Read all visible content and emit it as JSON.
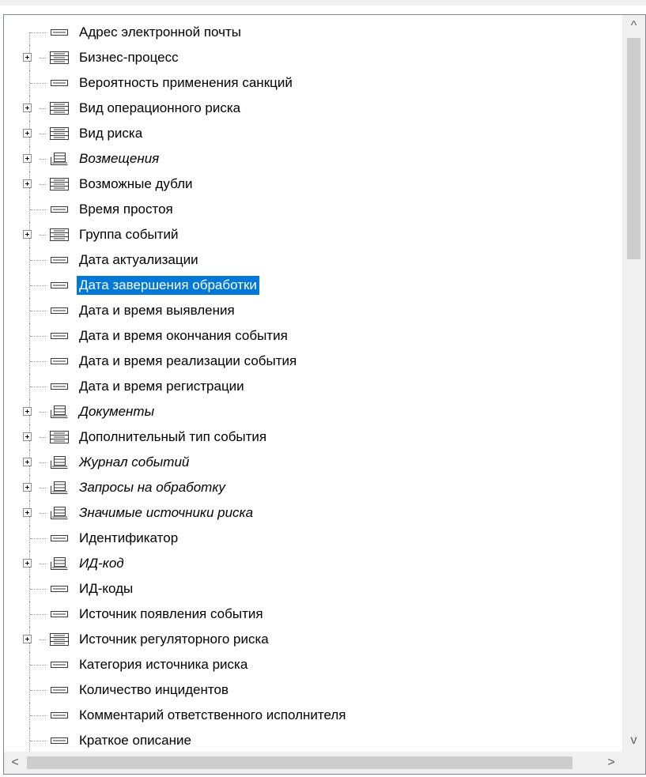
{
  "tree": {
    "items": [
      {
        "label": "Адрес электронной почты",
        "expandable": false,
        "icon": "field-icon",
        "italic": false,
        "selected": false
      },
      {
        "label": "Бизнес-процесс",
        "expandable": true,
        "icon": "reference-icon",
        "italic": false,
        "selected": false
      },
      {
        "label": "Вероятность применения санкций",
        "expandable": false,
        "icon": "field-icon",
        "italic": false,
        "selected": false
      },
      {
        "label": "Вид операционного риска",
        "expandable": true,
        "icon": "reference-icon",
        "italic": false,
        "selected": false
      },
      {
        "label": "Вид риска",
        "expandable": true,
        "icon": "reference-icon",
        "italic": false,
        "selected": false
      },
      {
        "label": "Возмещения",
        "expandable": true,
        "icon": "collection-icon",
        "italic": true,
        "selected": false
      },
      {
        "label": "Возможные дубли",
        "expandable": true,
        "icon": "reference-icon",
        "italic": false,
        "selected": false
      },
      {
        "label": "Время простоя",
        "expandable": false,
        "icon": "field-icon",
        "italic": false,
        "selected": false
      },
      {
        "label": "Группа событий",
        "expandable": true,
        "icon": "reference-icon",
        "italic": false,
        "selected": false
      },
      {
        "label": "Дата актуализации",
        "expandable": false,
        "icon": "field-icon",
        "italic": false,
        "selected": false
      },
      {
        "label": "Дата завершения обработки",
        "expandable": false,
        "icon": "field-icon",
        "italic": false,
        "selected": true
      },
      {
        "label": "Дата и время выявления",
        "expandable": false,
        "icon": "field-icon",
        "italic": false,
        "selected": false
      },
      {
        "label": "Дата и время окончания события",
        "expandable": false,
        "icon": "field-icon",
        "italic": false,
        "selected": false
      },
      {
        "label": "Дата и время реализации события",
        "expandable": false,
        "icon": "field-icon",
        "italic": false,
        "selected": false
      },
      {
        "label": "Дата и время регистрации",
        "expandable": false,
        "icon": "field-icon",
        "italic": false,
        "selected": false
      },
      {
        "label": "Документы",
        "expandable": true,
        "icon": "collection-icon",
        "italic": true,
        "selected": false
      },
      {
        "label": "Дополнительный тип события",
        "expandable": true,
        "icon": "reference-icon",
        "italic": false,
        "selected": false
      },
      {
        "label": "Журнал событий",
        "expandable": true,
        "icon": "collection-icon",
        "italic": true,
        "selected": false
      },
      {
        "label": "Запросы на обработку",
        "expandable": true,
        "icon": "collection-icon",
        "italic": true,
        "selected": false
      },
      {
        "label": "Значимые источники риска",
        "expandable": true,
        "icon": "collection-icon",
        "italic": true,
        "selected": false
      },
      {
        "label": "Идентификатор",
        "expandable": false,
        "icon": "field-icon",
        "italic": false,
        "selected": false
      },
      {
        "label": "ИД-код",
        "expandable": true,
        "icon": "collection-icon",
        "italic": true,
        "selected": false
      },
      {
        "label": "ИД-коды",
        "expandable": false,
        "icon": "field-icon",
        "italic": false,
        "selected": false
      },
      {
        "label": "Источник появления события",
        "expandable": false,
        "icon": "field-icon",
        "italic": false,
        "selected": false
      },
      {
        "label": "Источник регуляторного риска",
        "expandable": true,
        "icon": "reference-icon",
        "italic": false,
        "selected": false
      },
      {
        "label": "Категория источника риска",
        "expandable": false,
        "icon": "field-icon",
        "italic": false,
        "selected": false
      },
      {
        "label": "Количество инцидентов",
        "expandable": false,
        "icon": "field-icon",
        "italic": false,
        "selected": false
      },
      {
        "label": "Комментарий ответственного исполнителя",
        "expandable": false,
        "icon": "field-icon",
        "italic": false,
        "selected": false
      },
      {
        "label": "Краткое описание",
        "expandable": false,
        "icon": "field-icon",
        "italic": false,
        "selected": false
      }
    ]
  },
  "scrollbars": {
    "up_arrow": "^",
    "down_arrow": "v",
    "left_arrow": "<",
    "right_arrow": ">"
  },
  "colors": {
    "selection": "#0078d7",
    "selection_text": "#ffffff",
    "scrollbar_track": "#f0f0f0",
    "scrollbar_thumb": "#cdcdcd"
  }
}
